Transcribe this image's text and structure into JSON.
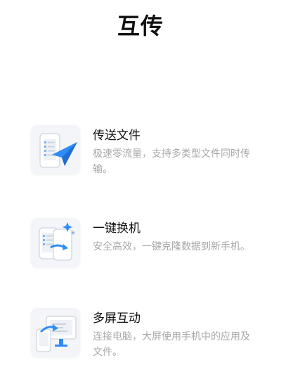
{
  "page": {
    "title": "互传"
  },
  "features": [
    {
      "icon": "send-file-icon",
      "title": "传送文件",
      "description": "极速零流量，支持多类型文件同时传输。"
    },
    {
      "icon": "phone-clone-icon",
      "title": "一键换机",
      "description": "安全高效，一键克隆数据到新手机。"
    },
    {
      "icon": "multi-screen-icon",
      "title": "多屏互动",
      "description": "连接电脑，大屏使用手机中的应用及文件。"
    }
  ],
  "colors": {
    "accent": "#2f8cf5",
    "title_text": "#111111",
    "description_text": "#a8a8a8",
    "icon_tile": "#f3f5f8"
  }
}
